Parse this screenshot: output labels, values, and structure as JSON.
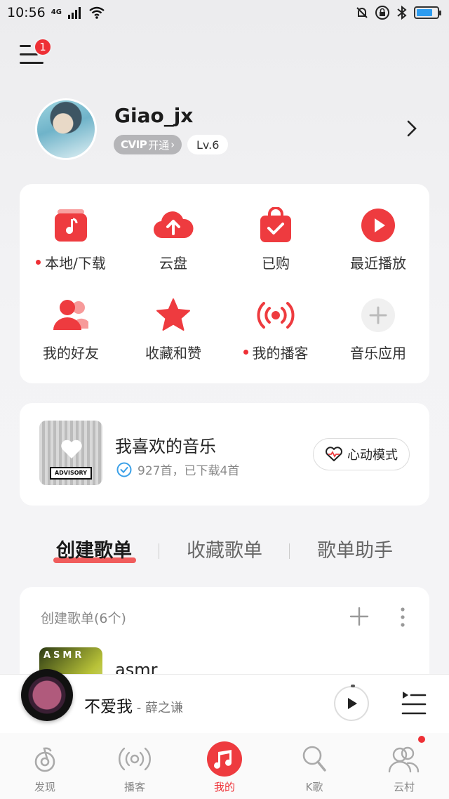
{
  "status_bar": {
    "time": "10:56",
    "signal_label": "4G"
  },
  "menu": {
    "badge_count": "1"
  },
  "profile": {
    "username": "Giao_jx",
    "vip_label": "开通",
    "level": "Lv.6"
  },
  "grid": [
    {
      "label": "本地/下载",
      "icon": "music-note-icon",
      "dot": true
    },
    {
      "label": "云盘",
      "icon": "cloud-upload-icon",
      "dot": false
    },
    {
      "label": "已购",
      "icon": "shopping-bag-icon",
      "dot": false
    },
    {
      "label": "最近播放",
      "icon": "play-circle-icon",
      "dot": false
    },
    {
      "label": "我的好友",
      "icon": "friends-icon",
      "dot": false
    },
    {
      "label": "收藏和赞",
      "icon": "star-icon",
      "dot": false
    },
    {
      "label": "我的播客",
      "icon": "podcast-icon",
      "dot": true
    },
    {
      "label": "音乐应用",
      "icon": "plus-icon",
      "dot": false
    }
  ],
  "favorites": {
    "title": "我喜欢的音乐",
    "subtitle": "927首，已下载4首",
    "mode_button": "心动模式",
    "cover_text": "ADVISORY"
  },
  "tabs": [
    {
      "label": "创建歌单",
      "active": true
    },
    {
      "label": "收藏歌单",
      "active": false
    },
    {
      "label": "歌单助手",
      "active": false
    }
  ],
  "playlists": {
    "header": "创建歌单(6个)",
    "items": [
      {
        "name": "asmr",
        "cover_text": "ASMR"
      }
    ]
  },
  "player": {
    "song": "不爱我",
    "artist": " - 薛之谦"
  },
  "tabbar": [
    {
      "label": "发现",
      "icon": "discover-icon",
      "active": false
    },
    {
      "label": "播客",
      "icon": "podcast-icon",
      "active": false
    },
    {
      "label": "我的",
      "icon": "music-note-icon",
      "active": true
    },
    {
      "label": "K歌",
      "icon": "microphone-icon",
      "active": false
    },
    {
      "label": "云村",
      "icon": "community-icon",
      "active": false
    }
  ],
  "colors": {
    "accent": "#ee2f35",
    "background": "#f3f3f5",
    "card": "#ffffff"
  }
}
